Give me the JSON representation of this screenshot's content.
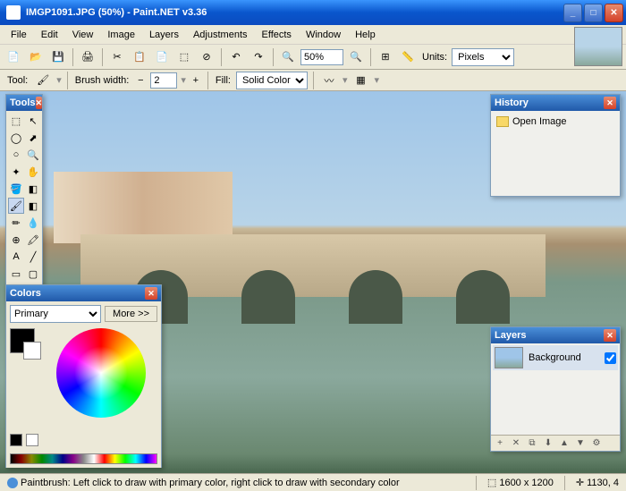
{
  "titlebar": {
    "text": "IMGP1091.JPG (50%) - Paint.NET v3.36"
  },
  "menu": {
    "items": [
      "File",
      "Edit",
      "View",
      "Image",
      "Layers",
      "Adjustments",
      "Effects",
      "Window",
      "Help"
    ]
  },
  "toolbar": {
    "zoom_value": "50%",
    "units_label": "Units:",
    "units_value": "Pixels"
  },
  "toolopts": {
    "tool_label": "Tool:",
    "brush_label": "Brush width:",
    "brush_value": "2",
    "fill_label": "Fill:",
    "fill_value": "Solid Color"
  },
  "panels": {
    "tools_title": "Tools",
    "colors_title": "Colors",
    "history_title": "History",
    "layers_title": "Layers"
  },
  "colors": {
    "mode_value": "Primary",
    "more_label": "More >>"
  },
  "history": {
    "items": [
      {
        "label": "Open Image"
      }
    ]
  },
  "layers": {
    "items": [
      {
        "name": "Background",
        "visible": true
      }
    ]
  },
  "status": {
    "hint": "Paintbrush: Left click to draw with primary color, right click to draw with secondary color",
    "dimensions": "1600 x 1200",
    "cursor": "1130, 4"
  }
}
